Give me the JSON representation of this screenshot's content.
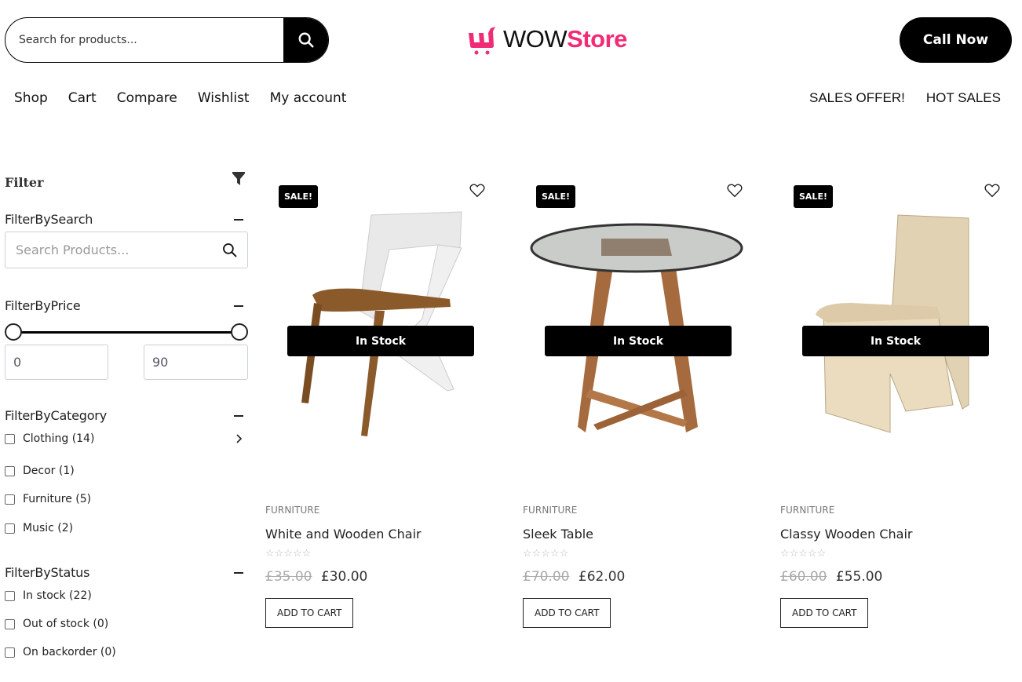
{
  "header": {
    "search_placeholder": "Search for products...",
    "logo_wow": "WOW",
    "logo_store": "Store",
    "call_label": "Call Now",
    "brand_color": "#f12b76"
  },
  "nav": {
    "main": [
      "Shop",
      "Cart",
      "Compare",
      "Wishlist",
      "My account"
    ],
    "right": [
      "SALES OFFER!",
      "HOT SALES"
    ]
  },
  "sidebar": {
    "title": "Filter",
    "search": {
      "title": "FilterBySearch",
      "placeholder": "Search Products..."
    },
    "price": {
      "title": "FilterByPrice",
      "min": "0",
      "max": "90",
      "range_low_fraction": 0,
      "range_high_fraction": 1
    },
    "category": {
      "title": "FilterByCategory",
      "items": [
        {
          "label": "Clothing (14)",
          "has_children": true
        },
        {
          "label": "Decor (1)"
        },
        {
          "label": "Furniture (5)"
        },
        {
          "label": "Music (2)"
        }
      ]
    },
    "status": {
      "title": "FilterByStatus",
      "items": [
        {
          "label": "In stock (22)"
        },
        {
          "label": "Out of stock (0)"
        },
        {
          "label": "On backorder (0)"
        }
      ]
    }
  },
  "products": [
    {
      "badge": "SALE!",
      "stock": "In Stock",
      "category": "FURNITURE",
      "title": "White and Wooden Chair",
      "rating": 0,
      "stars": "☆☆☆☆☆",
      "old_price": "£35.00",
      "price": "£30.00",
      "cta": "ADD TO CART"
    },
    {
      "badge": "SALE!",
      "stock": "In Stock",
      "category": "FURNITURE",
      "title": "Sleek Table",
      "rating": 0,
      "stars": "☆☆☆☆☆",
      "old_price": "£70.00",
      "price": "£62.00",
      "cta": "ADD TO CART"
    },
    {
      "badge": "SALE!",
      "stock": "In Stock",
      "category": "FURNITURE",
      "title": "Classy Wooden Chair",
      "rating": 0,
      "stars": "☆☆☆☆☆",
      "old_price": "£60.00",
      "price": "£55.00",
      "cta": "ADD TO CART"
    }
  ]
}
